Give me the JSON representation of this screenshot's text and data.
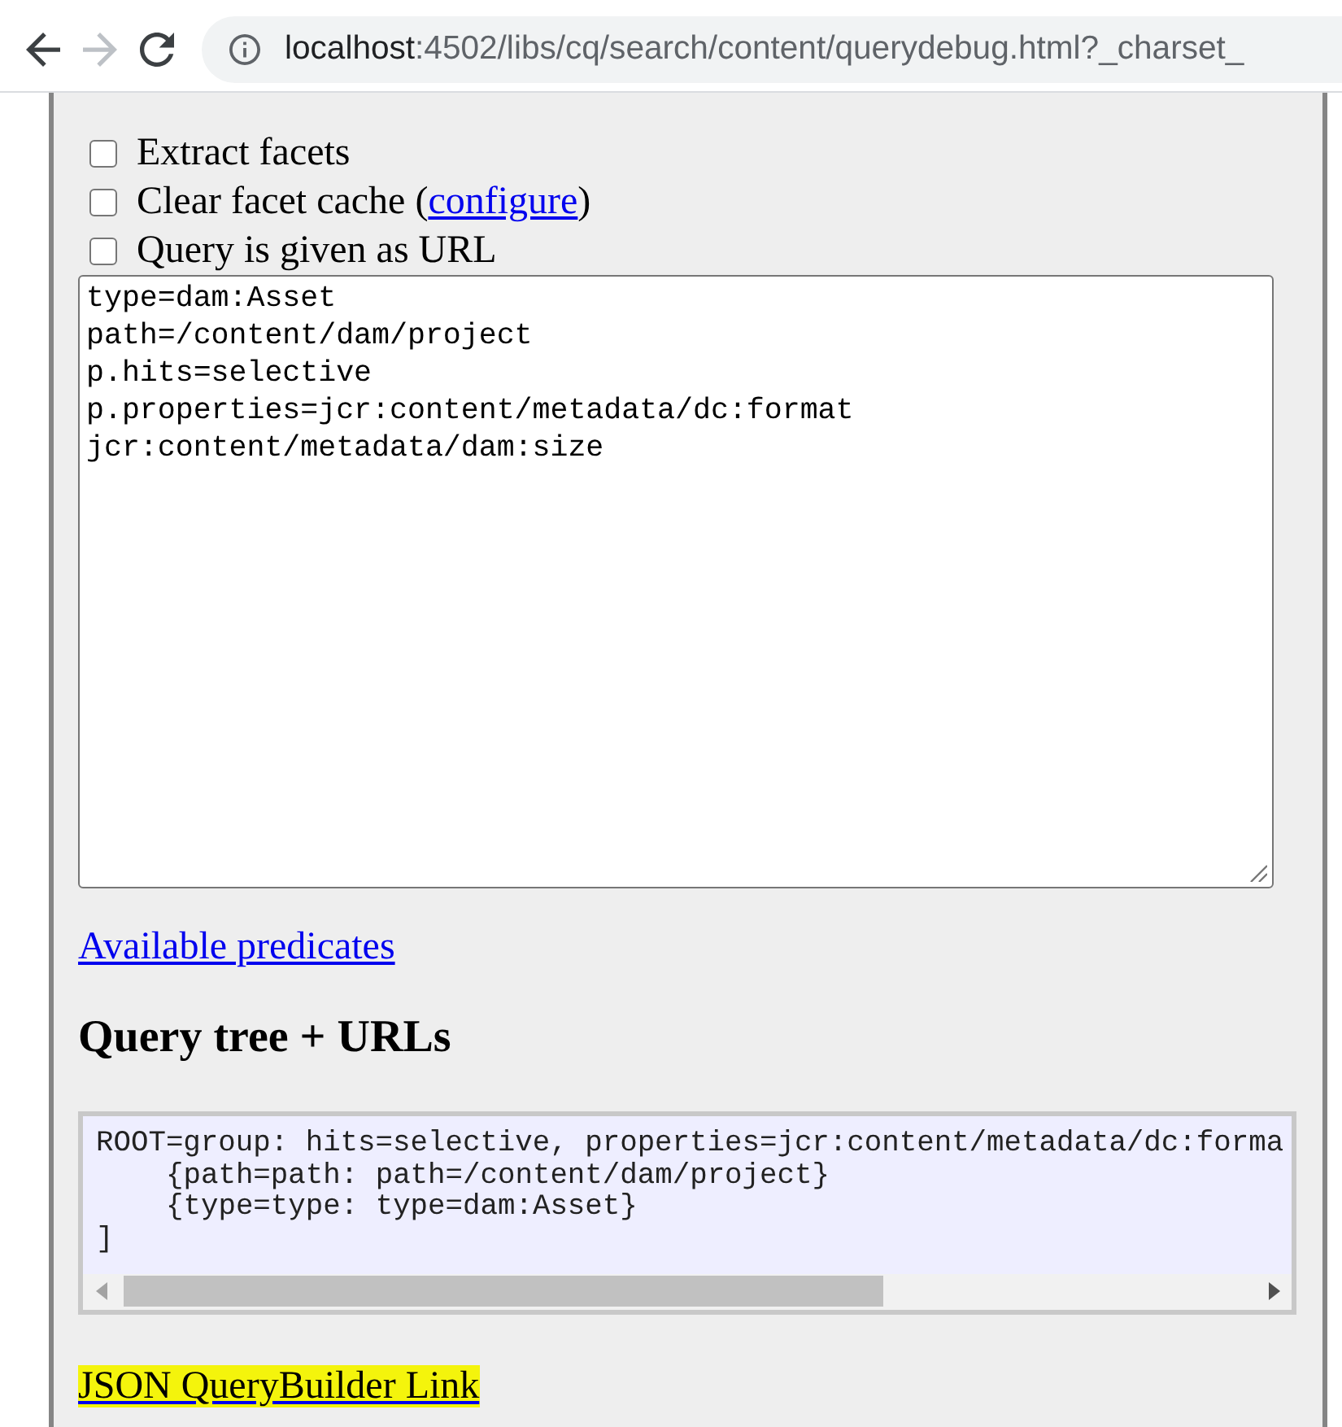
{
  "browser": {
    "nav": [
      {
        "kind": "back",
        "disabled": false
      },
      {
        "kind": "forward",
        "disabled": true
      },
      {
        "kind": "reload",
        "disabled": false
      }
    ],
    "url": {
      "host": "localhost",
      "rest": ":4502/libs/cq/search/content/querydebug.html?_charset_"
    }
  },
  "options": [
    {
      "label": "Extract facets",
      "checked": false
    },
    {
      "label": "Clear facet cache (",
      "link": "configure",
      "label_after": ")",
      "checked": false
    },
    {
      "label": "Query is given as URL",
      "checked": false
    }
  ],
  "query": {
    "value": "type=dam:Asset\npath=/content/dam/project\np.hits=selective\np.properties=jcr:content/metadata/dc:format\njcr:content/metadata/dam:size"
  },
  "predicates_link": "Available predicates",
  "heading": "Query tree + URLs",
  "query_tree": {
    "text": "ROOT=group: hits=selective, properties=jcr:content/metadata/dc:forma",
    "children": [
      {
        "text": "{path=path: path=/content/dam/project}"
      },
      {
        "text": "{type=type: type=dam:Asset}"
      }
    ],
    "close": "]"
  },
  "querybuilder_link": {
    "text": "JSON QueryBuilder Link",
    "highlighted": true
  }
}
